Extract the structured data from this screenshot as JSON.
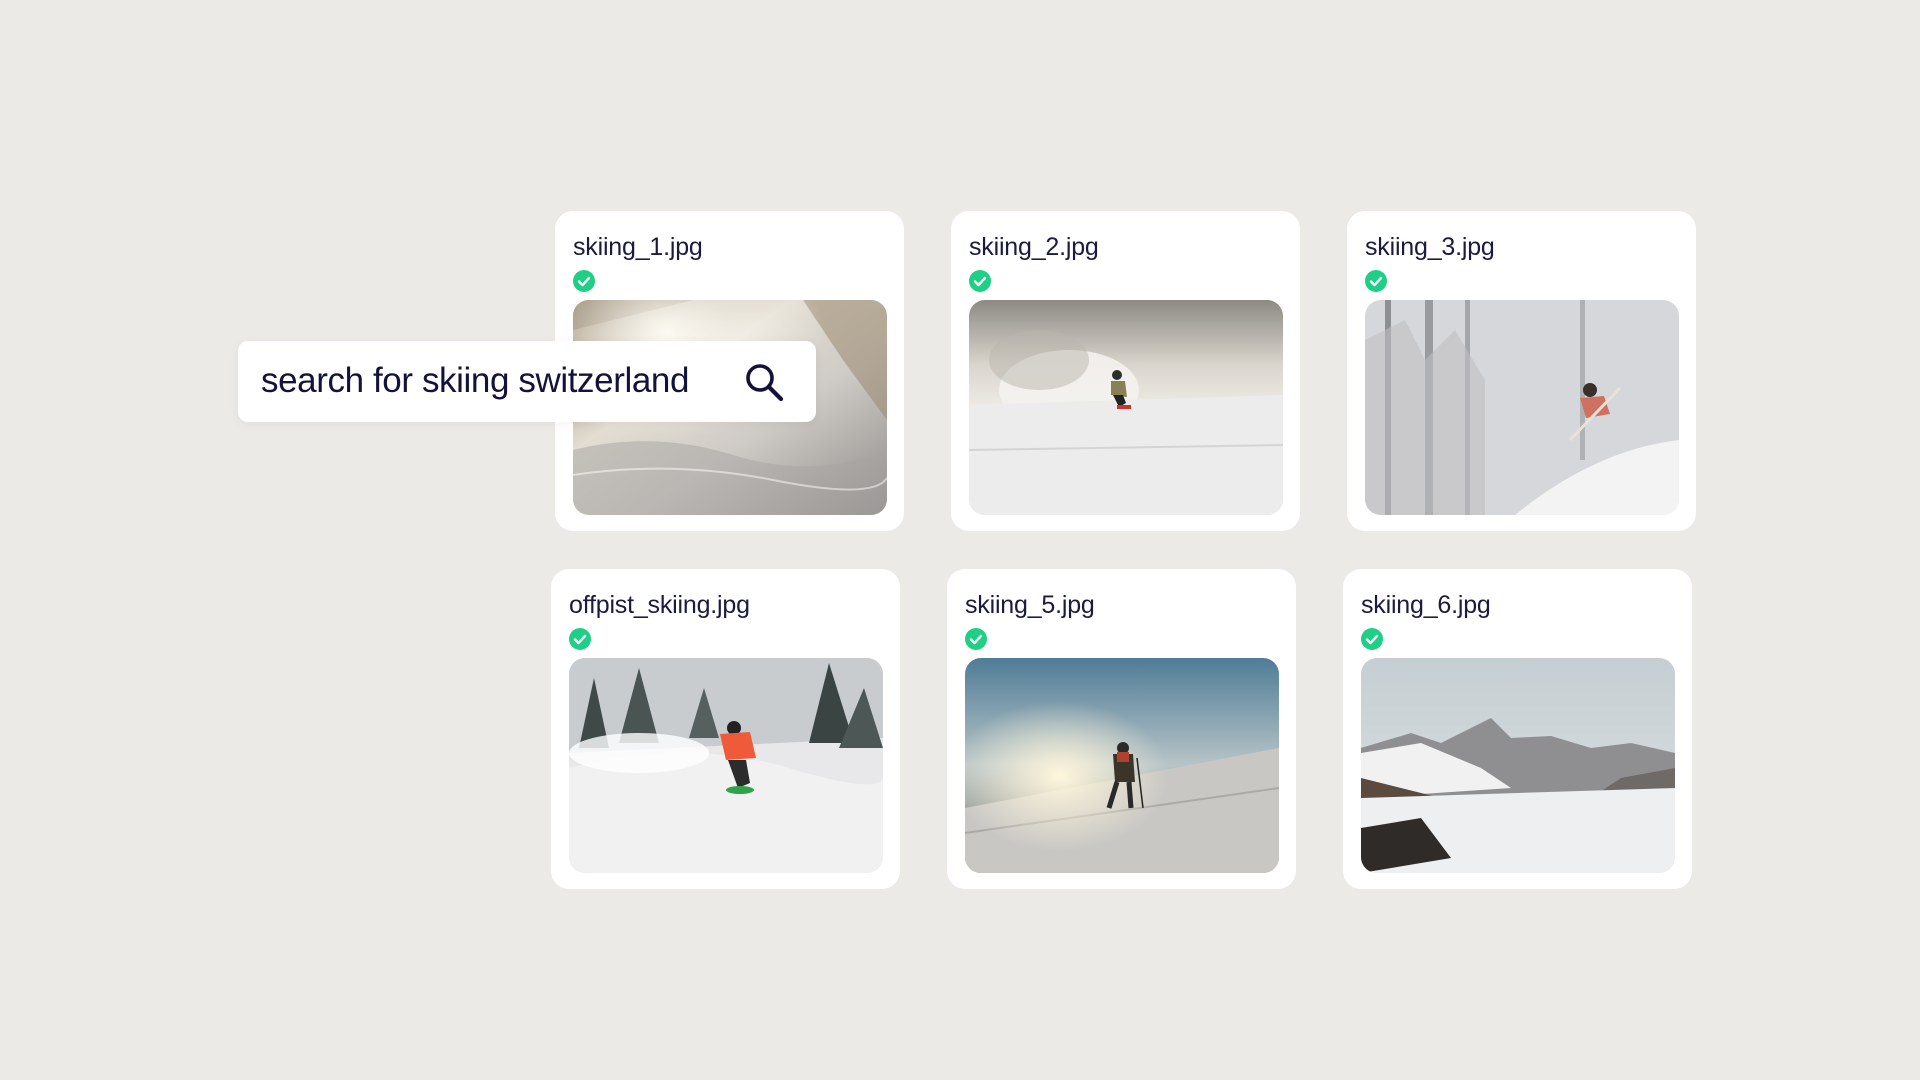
{
  "search": {
    "query": "search for skiing switzerland",
    "icon": "search-icon"
  },
  "results": [
    {
      "filename": "skiing_1.jpg",
      "status": "success",
      "status_icon": "check-circle-icon"
    },
    {
      "filename": "skiing_2.jpg",
      "status": "success",
      "status_icon": "check-circle-icon"
    },
    {
      "filename": "skiing_3.jpg",
      "status": "success",
      "status_icon": "check-circle-icon"
    },
    {
      "filename": "offpist_skiing.jpg",
      "status": "success",
      "status_icon": "check-circle-icon"
    },
    {
      "filename": "skiing_5.jpg",
      "status": "success",
      "status_icon": "check-circle-icon"
    },
    {
      "filename": "skiing_6.jpg",
      "status": "success",
      "status_icon": "check-circle-icon"
    }
  ],
  "colors": {
    "background": "#ebeae7",
    "card": "#ffffff",
    "text": "#1b1a3f",
    "success": "#1fcf86"
  }
}
